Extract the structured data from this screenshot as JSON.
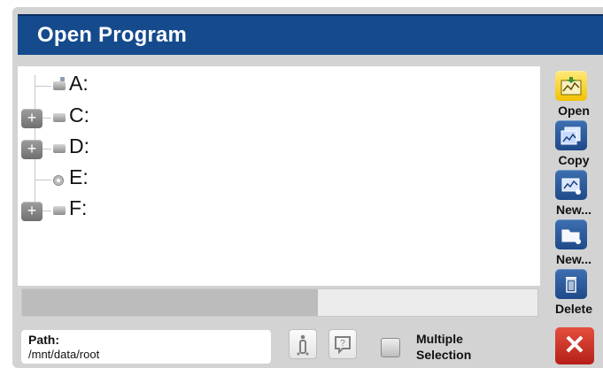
{
  "window": {
    "title": "Open Program"
  },
  "tree": {
    "drives": [
      {
        "label": "A:",
        "expandable": false,
        "icon": "network-drive-icon"
      },
      {
        "label": "C:",
        "expandable": true,
        "icon": "hard-drive-icon"
      },
      {
        "label": "D:",
        "expandable": true,
        "icon": "hard-drive-icon"
      },
      {
        "label": "E:",
        "expandable": false,
        "icon": "optical-drive-icon"
      },
      {
        "label": "F:",
        "expandable": true,
        "icon": "hard-drive-icon"
      }
    ],
    "expander_symbol": "+"
  },
  "actions": [
    {
      "label": "Open",
      "icon": "open-program-icon"
    },
    {
      "label": "Copy",
      "icon": "copy-icon"
    },
    {
      "label": "New...",
      "icon": "new-program-icon"
    },
    {
      "label": "New...",
      "icon": "new-folder-icon"
    },
    {
      "label": "Delete",
      "icon": "trash-icon"
    }
  ],
  "footer": {
    "path_label": "Path:",
    "path_value": "/mnt/data/root",
    "info_icon": "info-icon",
    "help_icon": "help-icon",
    "multiple_selection_line1": "Multiple",
    "multiple_selection_line2": "Selection",
    "close_icon": "close-icon"
  },
  "colors": {
    "titlebar": "#154b8d",
    "action_button": "#2b5c9c",
    "open_button": "#f2c200",
    "close_button": "#c92a22"
  },
  "scroll": {
    "horizontal_fraction_visible": 0.57
  }
}
